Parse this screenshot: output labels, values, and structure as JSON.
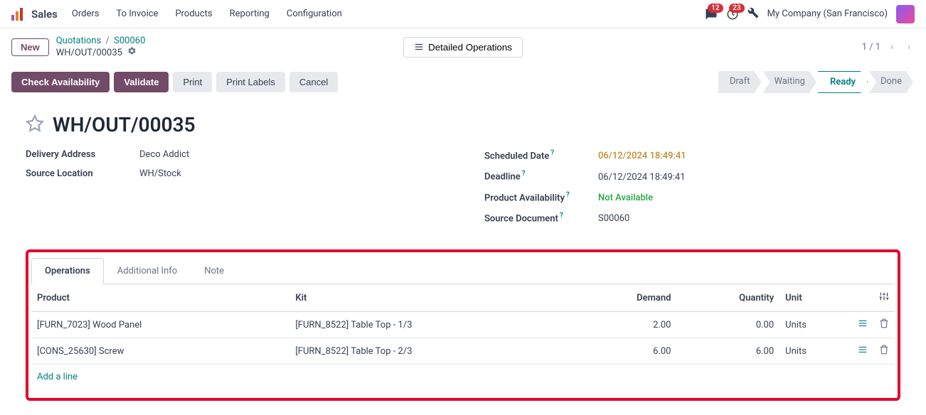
{
  "topbar": {
    "app": "Sales",
    "menu": [
      "Orders",
      "To Invoice",
      "Products",
      "Reporting",
      "Configuration"
    ],
    "msg_badge": "12",
    "activity_badge": "23",
    "company": "My Company (San Francisco)"
  },
  "header": {
    "new": "New",
    "bc1": "Quotations",
    "bc2": "S00060",
    "bc3": "WH/OUT/00035",
    "detailed": "Detailed Operations",
    "pager": "1 / 1"
  },
  "actions": {
    "check": "Check Availability",
    "validate": "Validate",
    "print": "Print",
    "labels": "Print Labels",
    "cancel": "Cancel"
  },
  "status": [
    "Draft",
    "Waiting",
    "Ready",
    "Done"
  ],
  "title": "WH/OUT/00035",
  "left": {
    "addr_l": "Delivery Address",
    "addr_v": "Deco Addict",
    "src_l": "Source Location",
    "src_v": "WH/Stock"
  },
  "right": {
    "sched_l": "Scheduled Date",
    "sched_v": "06/12/2024 18:49:41",
    "dead_l": "Deadline",
    "dead_v": "06/12/2024 18:49:41",
    "avail_l": "Product Availability",
    "avail_v": "Not Available",
    "doc_l": "Source Document",
    "doc_v": "S00060"
  },
  "tabs": [
    "Operations",
    "Additional Info",
    "Note"
  ],
  "cols": {
    "product": "Product",
    "kit": "Kit",
    "demand": "Demand",
    "qty": "Quantity",
    "unit": "Unit"
  },
  "rows": [
    {
      "product": "[FURN_7023] Wood Panel",
      "kit": "[FURN_8522] Table Top - 1/3",
      "demand": "2.00",
      "qty": "0.00",
      "unit": "Units"
    },
    {
      "product": "[CONS_25630] Screw",
      "kit": "[FURN_8522] Table Top - 2/3",
      "demand": "6.00",
      "qty": "6.00",
      "unit": "Units"
    }
  ],
  "add_line": "Add a line"
}
